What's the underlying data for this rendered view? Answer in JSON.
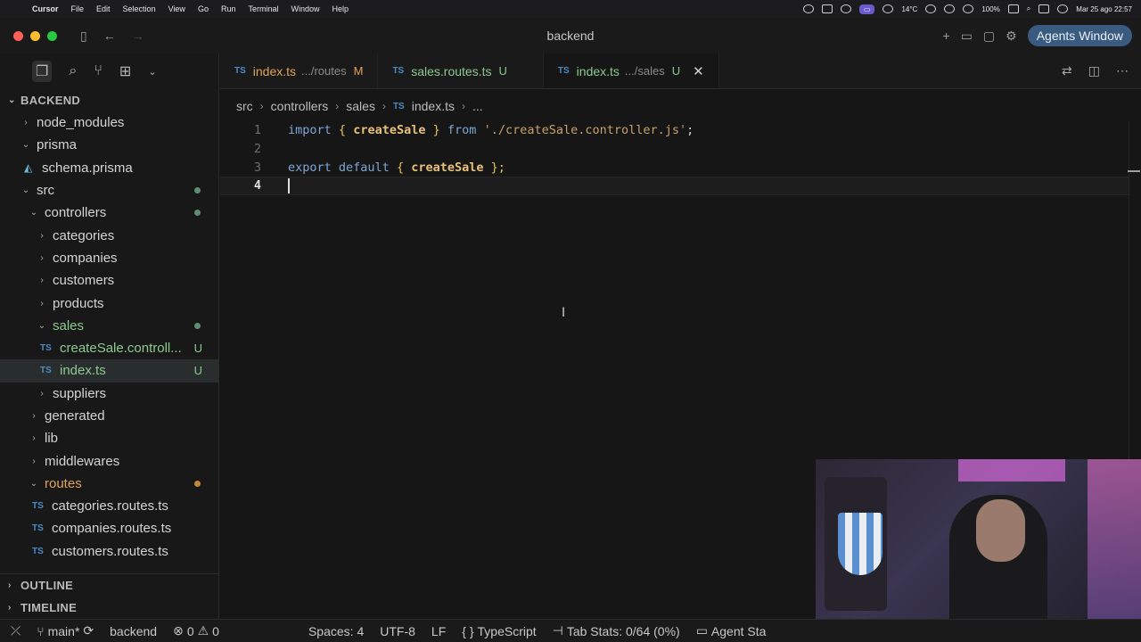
{
  "menubar": {
    "app": "Cursor",
    "items": [
      "File",
      "Edit",
      "Selection",
      "View",
      "Go",
      "Run",
      "Terminal",
      "Window",
      "Help"
    ],
    "temp": "14°C",
    "battery": "100%",
    "datetime": "Mar 25 ago  22:57"
  },
  "titlebar": {
    "title": "backend",
    "agents_label": "Agents Window"
  },
  "sidebar": {
    "section": "BACKEND",
    "tree": [
      {
        "label": "node_modules",
        "type": "folder",
        "depth": 1,
        "open": false
      },
      {
        "label": "prisma",
        "type": "folder",
        "depth": 1,
        "open": true
      },
      {
        "label": "schema.prisma",
        "type": "prisma",
        "depth": 1
      },
      {
        "label": "src",
        "type": "folder",
        "depth": 1,
        "open": true,
        "dot": "green"
      },
      {
        "label": "controllers",
        "type": "folder",
        "depth": 2,
        "open": true,
        "dot": "green"
      },
      {
        "label": "categories",
        "type": "folder",
        "depth": 3,
        "open": false
      },
      {
        "label": "companies",
        "type": "folder",
        "depth": 3,
        "open": false
      },
      {
        "label": "customers",
        "type": "folder",
        "depth": 3,
        "open": false
      },
      {
        "label": "products",
        "type": "folder",
        "depth": 3,
        "open": false
      },
      {
        "label": "sales",
        "type": "folder",
        "depth": 3,
        "open": true,
        "dot": "green",
        "color": "green"
      },
      {
        "label": "createSale.controll...",
        "type": "ts",
        "depth": 3,
        "badge": "U",
        "color": "green"
      },
      {
        "label": "index.ts",
        "type": "ts",
        "depth": 3,
        "badge": "U",
        "color": "green",
        "selected": true
      },
      {
        "label": "suppliers",
        "type": "folder",
        "depth": 3,
        "open": false
      },
      {
        "label": "generated",
        "type": "folder",
        "depth": 2,
        "open": false
      },
      {
        "label": "lib",
        "type": "folder",
        "depth": 2,
        "open": false
      },
      {
        "label": "middlewares",
        "type": "folder",
        "depth": 2,
        "open": false
      },
      {
        "label": "routes",
        "type": "folder",
        "depth": 2,
        "open": true,
        "dot": "orange",
        "color": "orange"
      },
      {
        "label": "categories.routes.ts",
        "type": "ts",
        "depth": 2
      },
      {
        "label": "companies.routes.ts",
        "type": "ts",
        "depth": 2
      },
      {
        "label": "customers.routes.ts",
        "type": "ts",
        "depth": 2
      }
    ],
    "outline": "OUTLINE",
    "timeline": "TIMELINE"
  },
  "tabs": [
    {
      "name": "index.ts",
      "desc": ".../routes",
      "flag": "M",
      "state": "mod"
    },
    {
      "name": "sales.routes.ts",
      "desc": "",
      "flag": "U",
      "state": "untr"
    },
    {
      "name": "index.ts",
      "desc": ".../sales",
      "flag": "U",
      "state": "untr",
      "active": true
    }
  ],
  "breadcrumb": [
    "src",
    "controllers",
    "sales",
    "index.ts",
    "..."
  ],
  "code": {
    "line_numbers": [
      "1",
      "2",
      "3",
      "4"
    ],
    "line1": {
      "kw": "import",
      "open": "{",
      "name": "createSale",
      "close": "}",
      "from": "from",
      "str": "'./createSale.controller.js'",
      "end": ";"
    },
    "line3": {
      "kw1": "export",
      "kw2": "default",
      "open": "{",
      "name": "createSale",
      "close": "};"
    }
  },
  "statusbar": {
    "branch": "main*",
    "project": "backend",
    "errors": "0",
    "warnings": "0",
    "spaces": "Spaces: 4",
    "encoding": "UTF-8",
    "eol": "LF",
    "language": "TypeScript",
    "tabstats": "Tab Stats: 0/64 (0%)",
    "agent": "Agent Sta"
  }
}
